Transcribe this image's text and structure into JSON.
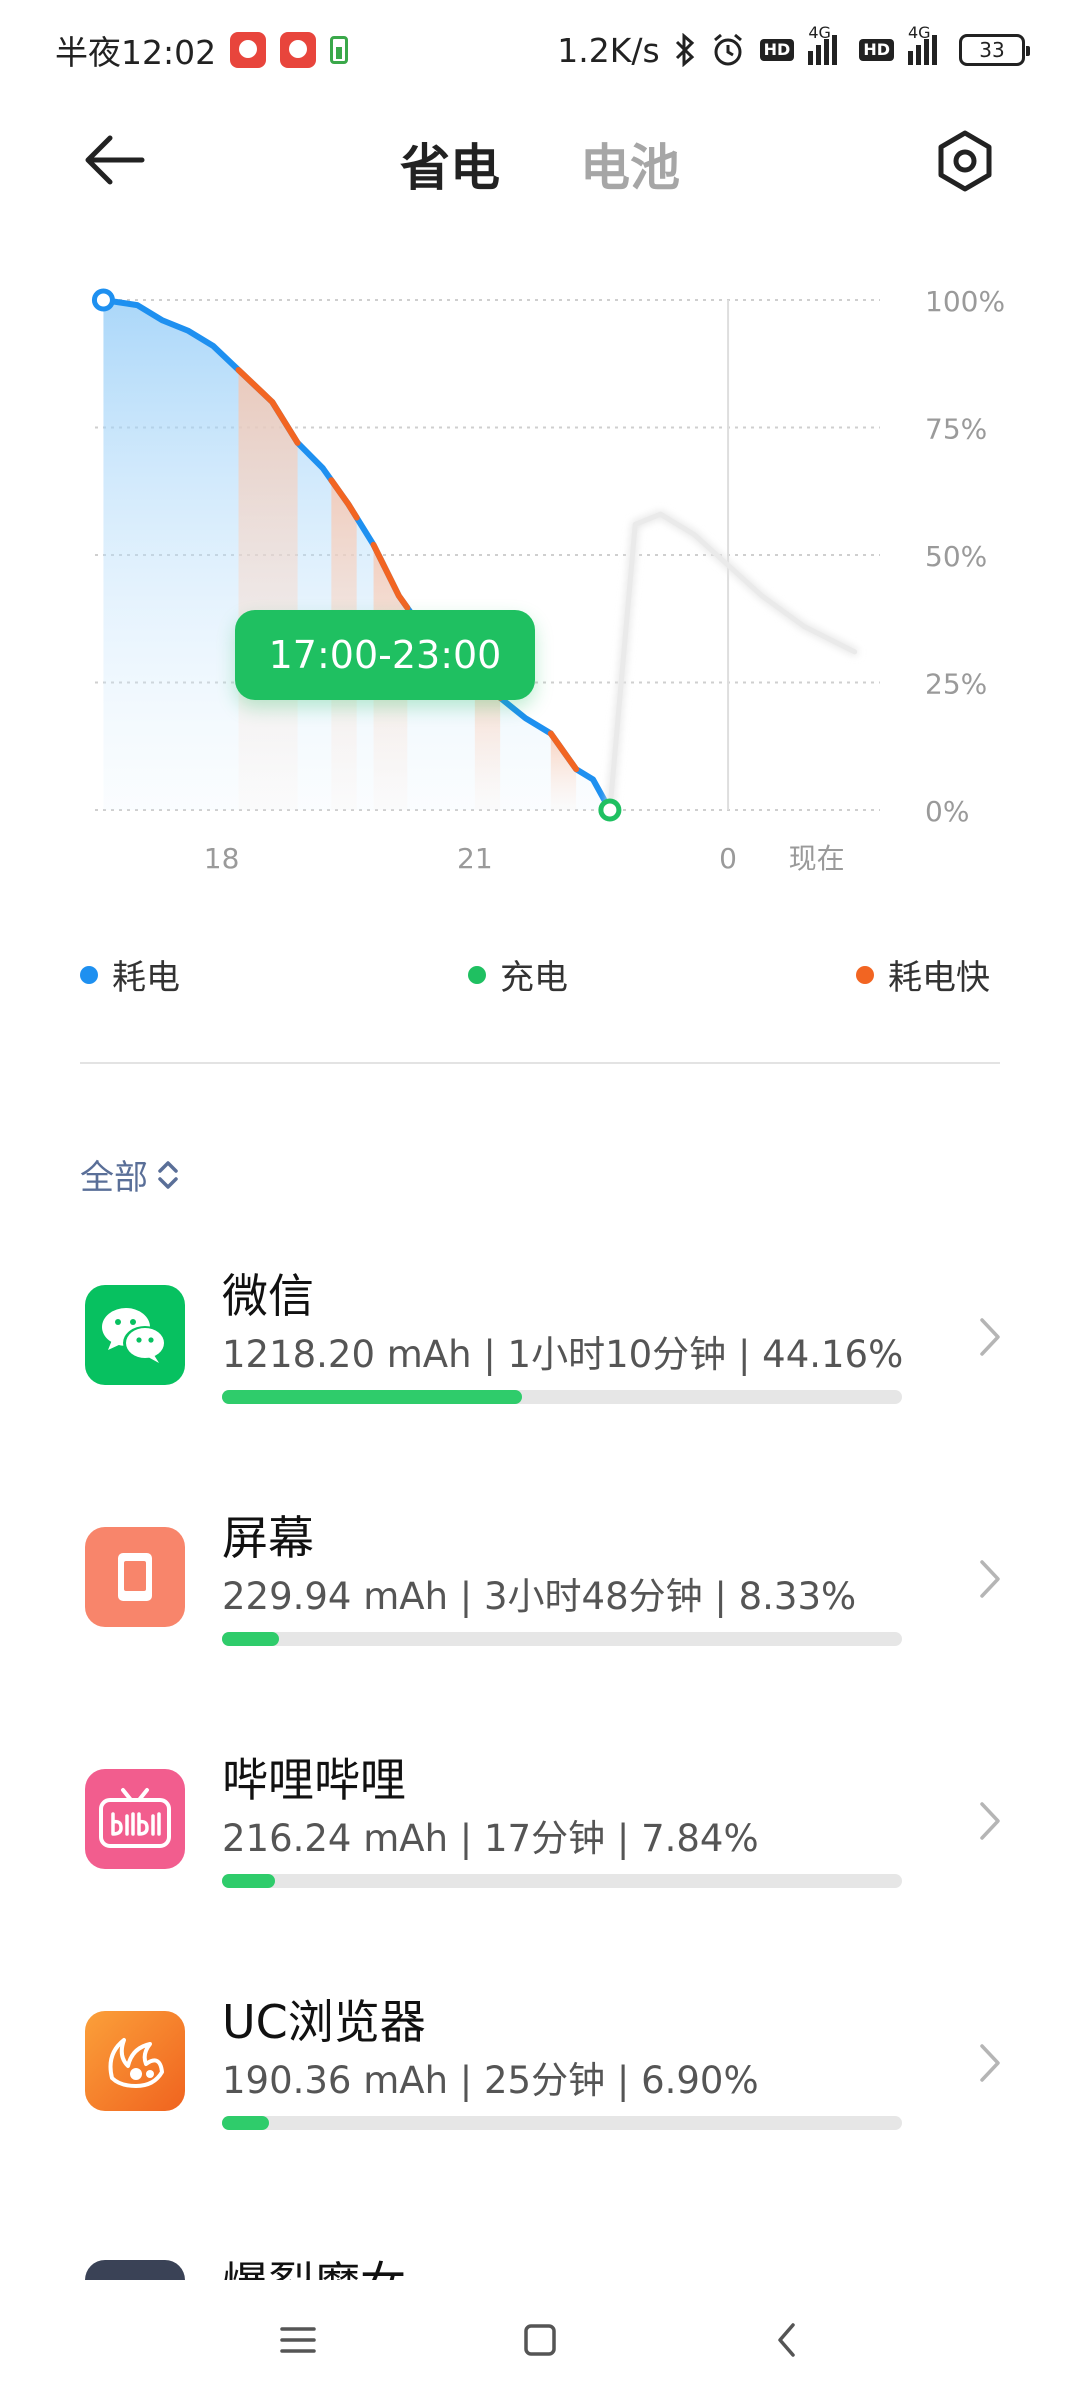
{
  "status_bar": {
    "time": "半夜12:02",
    "net_speed": "1.2K/s",
    "hd": "HD",
    "network": "4G",
    "battery_level": "33"
  },
  "header": {
    "tabs": [
      {
        "label": "省电",
        "active": true
      },
      {
        "label": "电池",
        "active": false
      }
    ],
    "icons": {
      "back": "arrow-left-icon",
      "settings": "hexagon-settings-icon"
    }
  },
  "chart_data": {
    "type": "line",
    "tooltip": "17:00-23:00",
    "y_ticks": [
      "100%",
      "75%",
      "50%",
      "25%",
      "0%"
    ],
    "x_ticks": [
      "18",
      "21",
      "0",
      "现在"
    ],
    "ylim": [
      0,
      100
    ],
    "xlim": [
      16.5,
      25.8
    ],
    "x_unit": "hour",
    "series": [
      {
        "name": "耗电",
        "color": "#1e90f0",
        "points": [
          [
            16.6,
            100
          ],
          [
            17.0,
            99
          ],
          [
            17.3,
            96
          ],
          [
            17.6,
            94
          ],
          [
            17.9,
            91
          ],
          [
            18.6,
            80
          ],
          [
            18.9,
            72
          ],
          [
            19.2,
            67
          ],
          [
            19.5,
            60
          ],
          [
            19.8,
            52
          ],
          [
            20.1,
            42
          ],
          [
            20.4,
            35
          ],
          [
            20.7,
            32
          ],
          [
            21.0,
            30
          ],
          [
            21.3,
            22
          ],
          [
            21.6,
            18
          ],
          [
            21.9,
            15
          ],
          [
            22.2,
            8
          ],
          [
            22.4,
            6
          ],
          [
            22.6,
            0
          ]
        ]
      },
      {
        "name": "耗电快",
        "color": "#f26522",
        "segments": [
          [
            18.2,
            18.9
          ],
          [
            19.3,
            19.6
          ],
          [
            19.8,
            20.2
          ],
          [
            21.0,
            21.3
          ],
          [
            21.9,
            22.2
          ]
        ]
      },
      {
        "name": "充电",
        "color": "#1fc061",
        "points": [
          [
            22.6,
            0
          ],
          [
            22.9,
            56
          ],
          [
            23.2,
            58
          ],
          [
            23.6,
            54
          ],
          [
            24.0,
            48
          ],
          [
            24.4,
            42
          ],
          [
            24.9,
            36
          ],
          [
            25.5,
            31
          ]
        ]
      }
    ],
    "grid": true
  },
  "legend": [
    {
      "label": "耗电",
      "color": "#1e90f0"
    },
    {
      "label": "充电",
      "color": "#1fc061"
    },
    {
      "label": "耗电快",
      "color": "#f26522"
    }
  ],
  "filter": {
    "label": "全部",
    "icon": "sort-updown-icon"
  },
  "apps": [
    {
      "name": "微信",
      "stats": "1218.20 mAh | 1小时10分钟 | 44.16%",
      "percent": 44.16,
      "icon": "wechat-icon",
      "color": "#07c160"
    },
    {
      "name": "屏幕",
      "stats": "229.94 mAh | 3小时48分钟 | 8.33%",
      "percent": 8.33,
      "icon": "screen-icon",
      "color": "#f8856b"
    },
    {
      "name": "哔哩哔哩",
      "stats": "216.24 mAh | 17分钟 | 7.84%",
      "percent": 7.84,
      "icon": "bilibili-icon",
      "color": "#f25d8e"
    },
    {
      "name": "UC浏览器",
      "stats": "190.36 mAh | 25分钟 | 6.90%",
      "percent": 6.9,
      "icon": "uc-browser-icon",
      "color": "#f77f2a"
    }
  ],
  "partial_app": {
    "name": "爆裂魔女"
  },
  "nav": {
    "icons": [
      "menu-icon",
      "home-icon",
      "back-icon"
    ]
  }
}
